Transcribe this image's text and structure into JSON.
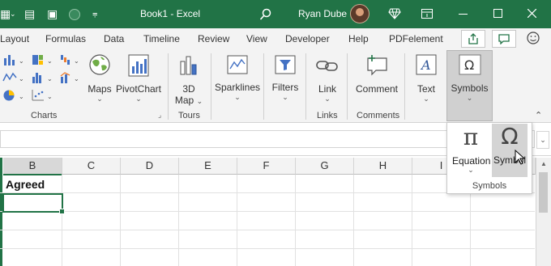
{
  "titlebar": {
    "doc_title": "Book1  -  Excel",
    "user_name": "Ryan Dube",
    "accent": "#217346"
  },
  "menu": {
    "tabs": [
      "Layout",
      "Formulas",
      "Data",
      "Timeline",
      "Review",
      "View",
      "Developer",
      "Help",
      "PDFelement"
    ]
  },
  "ribbon": {
    "maps": "Maps",
    "pivotchart": "PivotChart",
    "map3d_line1": "3D",
    "map3d_line2": "Map",
    "sparklines": "Sparklines",
    "filters": "Filters",
    "link": "Link",
    "comment": "Comment",
    "text": "Text",
    "symbols": "Symbols",
    "groups": {
      "charts": "Charts",
      "tours": "Tours",
      "links": "Links",
      "comments": "Comments"
    }
  },
  "grid": {
    "columns": [
      "B",
      "C",
      "D",
      "E",
      "F",
      "G",
      "H",
      "I"
    ],
    "cell_b1": "Agreed"
  },
  "popup": {
    "equation": "Equation",
    "symbol": "Symbol",
    "group": "Symbols"
  },
  "icons": [
    "grid-icon",
    "save-icon",
    "autosave-toggle",
    "customize-icon",
    "search-icon",
    "diamond-icon",
    "ribbon-display-icon",
    "minimize-icon",
    "restore-icon",
    "close-icon",
    "share-icon",
    "comments-icon",
    "smiley-icon",
    "omega-icon",
    "pi-icon"
  ]
}
